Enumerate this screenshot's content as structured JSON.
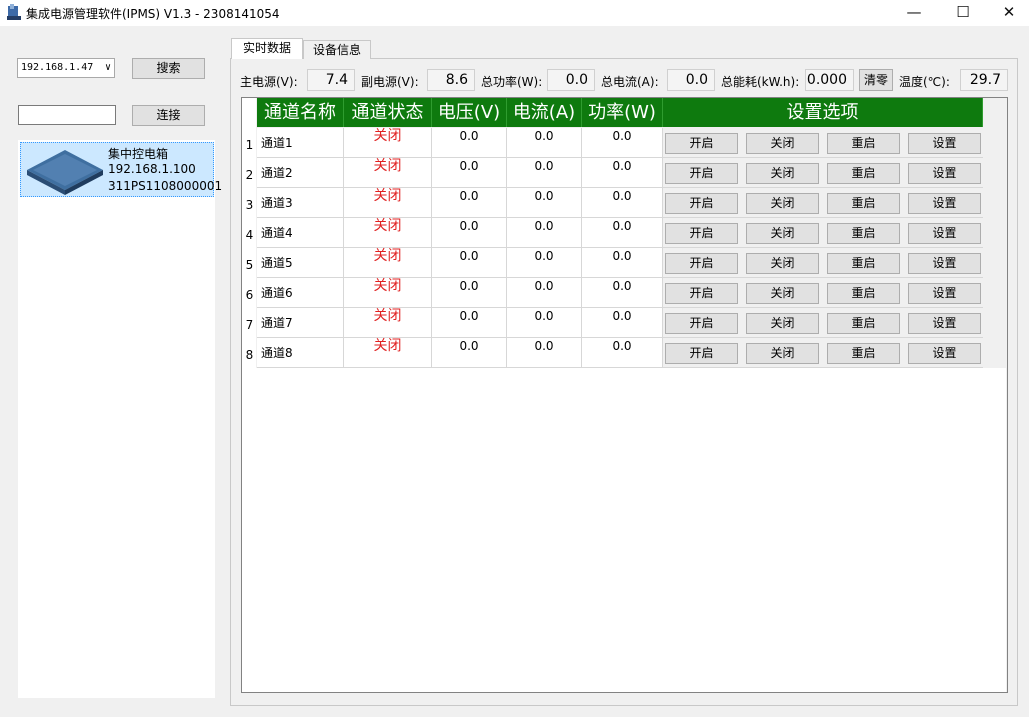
{
  "window": {
    "title": "集成电源管理软件(IPMS) V1.3 - 2308141054",
    "minimize_glyph": "—",
    "maximize_glyph": "☐",
    "close_glyph": "✕"
  },
  "left": {
    "ip_select": "192.168.1.47",
    "search_label": "搜索",
    "connect_value": "",
    "connect_label": "连接",
    "device": {
      "name": "集中控电箱",
      "ip": "192.168.1.100",
      "serial": "311PS1108000001"
    }
  },
  "tabs": [
    "实时数据",
    "设备信息"
  ],
  "summary": {
    "main_power_label": "主电源(V):",
    "main_power": "7.4",
    "aux_power_label": "副电源(V):",
    "aux_power": "8.6",
    "total_power_label": "总功率(W):",
    "total_power": "0.0",
    "total_current_label": "总电流(A):",
    "total_current": "0.0",
    "total_energy_label": "总能耗(kW.h):",
    "total_energy": "0.000",
    "clear_label": "清零",
    "temperature_label": "温度(℃):",
    "temperature": "29.7"
  },
  "grid": {
    "headers": [
      "通道名称",
      "通道状态",
      "电压(V)",
      "电流(A)",
      "功率(W)",
      "设置选项"
    ],
    "button_labels": [
      "开启",
      "关闭",
      "重启",
      "设置"
    ],
    "rows": [
      {
        "num": "1",
        "name": "通道1",
        "status": "关闭",
        "voltage": "0.0",
        "current": "0.0",
        "power": "0.0"
      },
      {
        "num": "2",
        "name": "通道2",
        "status": "关闭",
        "voltage": "0.0",
        "current": "0.0",
        "power": "0.0"
      },
      {
        "num": "3",
        "name": "通道3",
        "status": "关闭",
        "voltage": "0.0",
        "current": "0.0",
        "power": "0.0"
      },
      {
        "num": "4",
        "name": "通道4",
        "status": "关闭",
        "voltage": "0.0",
        "current": "0.0",
        "power": "0.0"
      },
      {
        "num": "5",
        "name": "通道5",
        "status": "关闭",
        "voltage": "0.0",
        "current": "0.0",
        "power": "0.0"
      },
      {
        "num": "6",
        "name": "通道6",
        "status": "关闭",
        "voltage": "0.0",
        "current": "0.0",
        "power": "0.0"
      },
      {
        "num": "7",
        "name": "通道7",
        "status": "关闭",
        "voltage": "0.0",
        "current": "0.0",
        "power": "0.0"
      },
      {
        "num": "8",
        "name": "通道8",
        "status": "关闭",
        "voltage": "0.0",
        "current": "0.0",
        "power": "0.0"
      }
    ]
  },
  "colors": {
    "header_green": "#0e7a0e",
    "status_red": "#e02020",
    "selection_blue": "#cce8ff"
  }
}
